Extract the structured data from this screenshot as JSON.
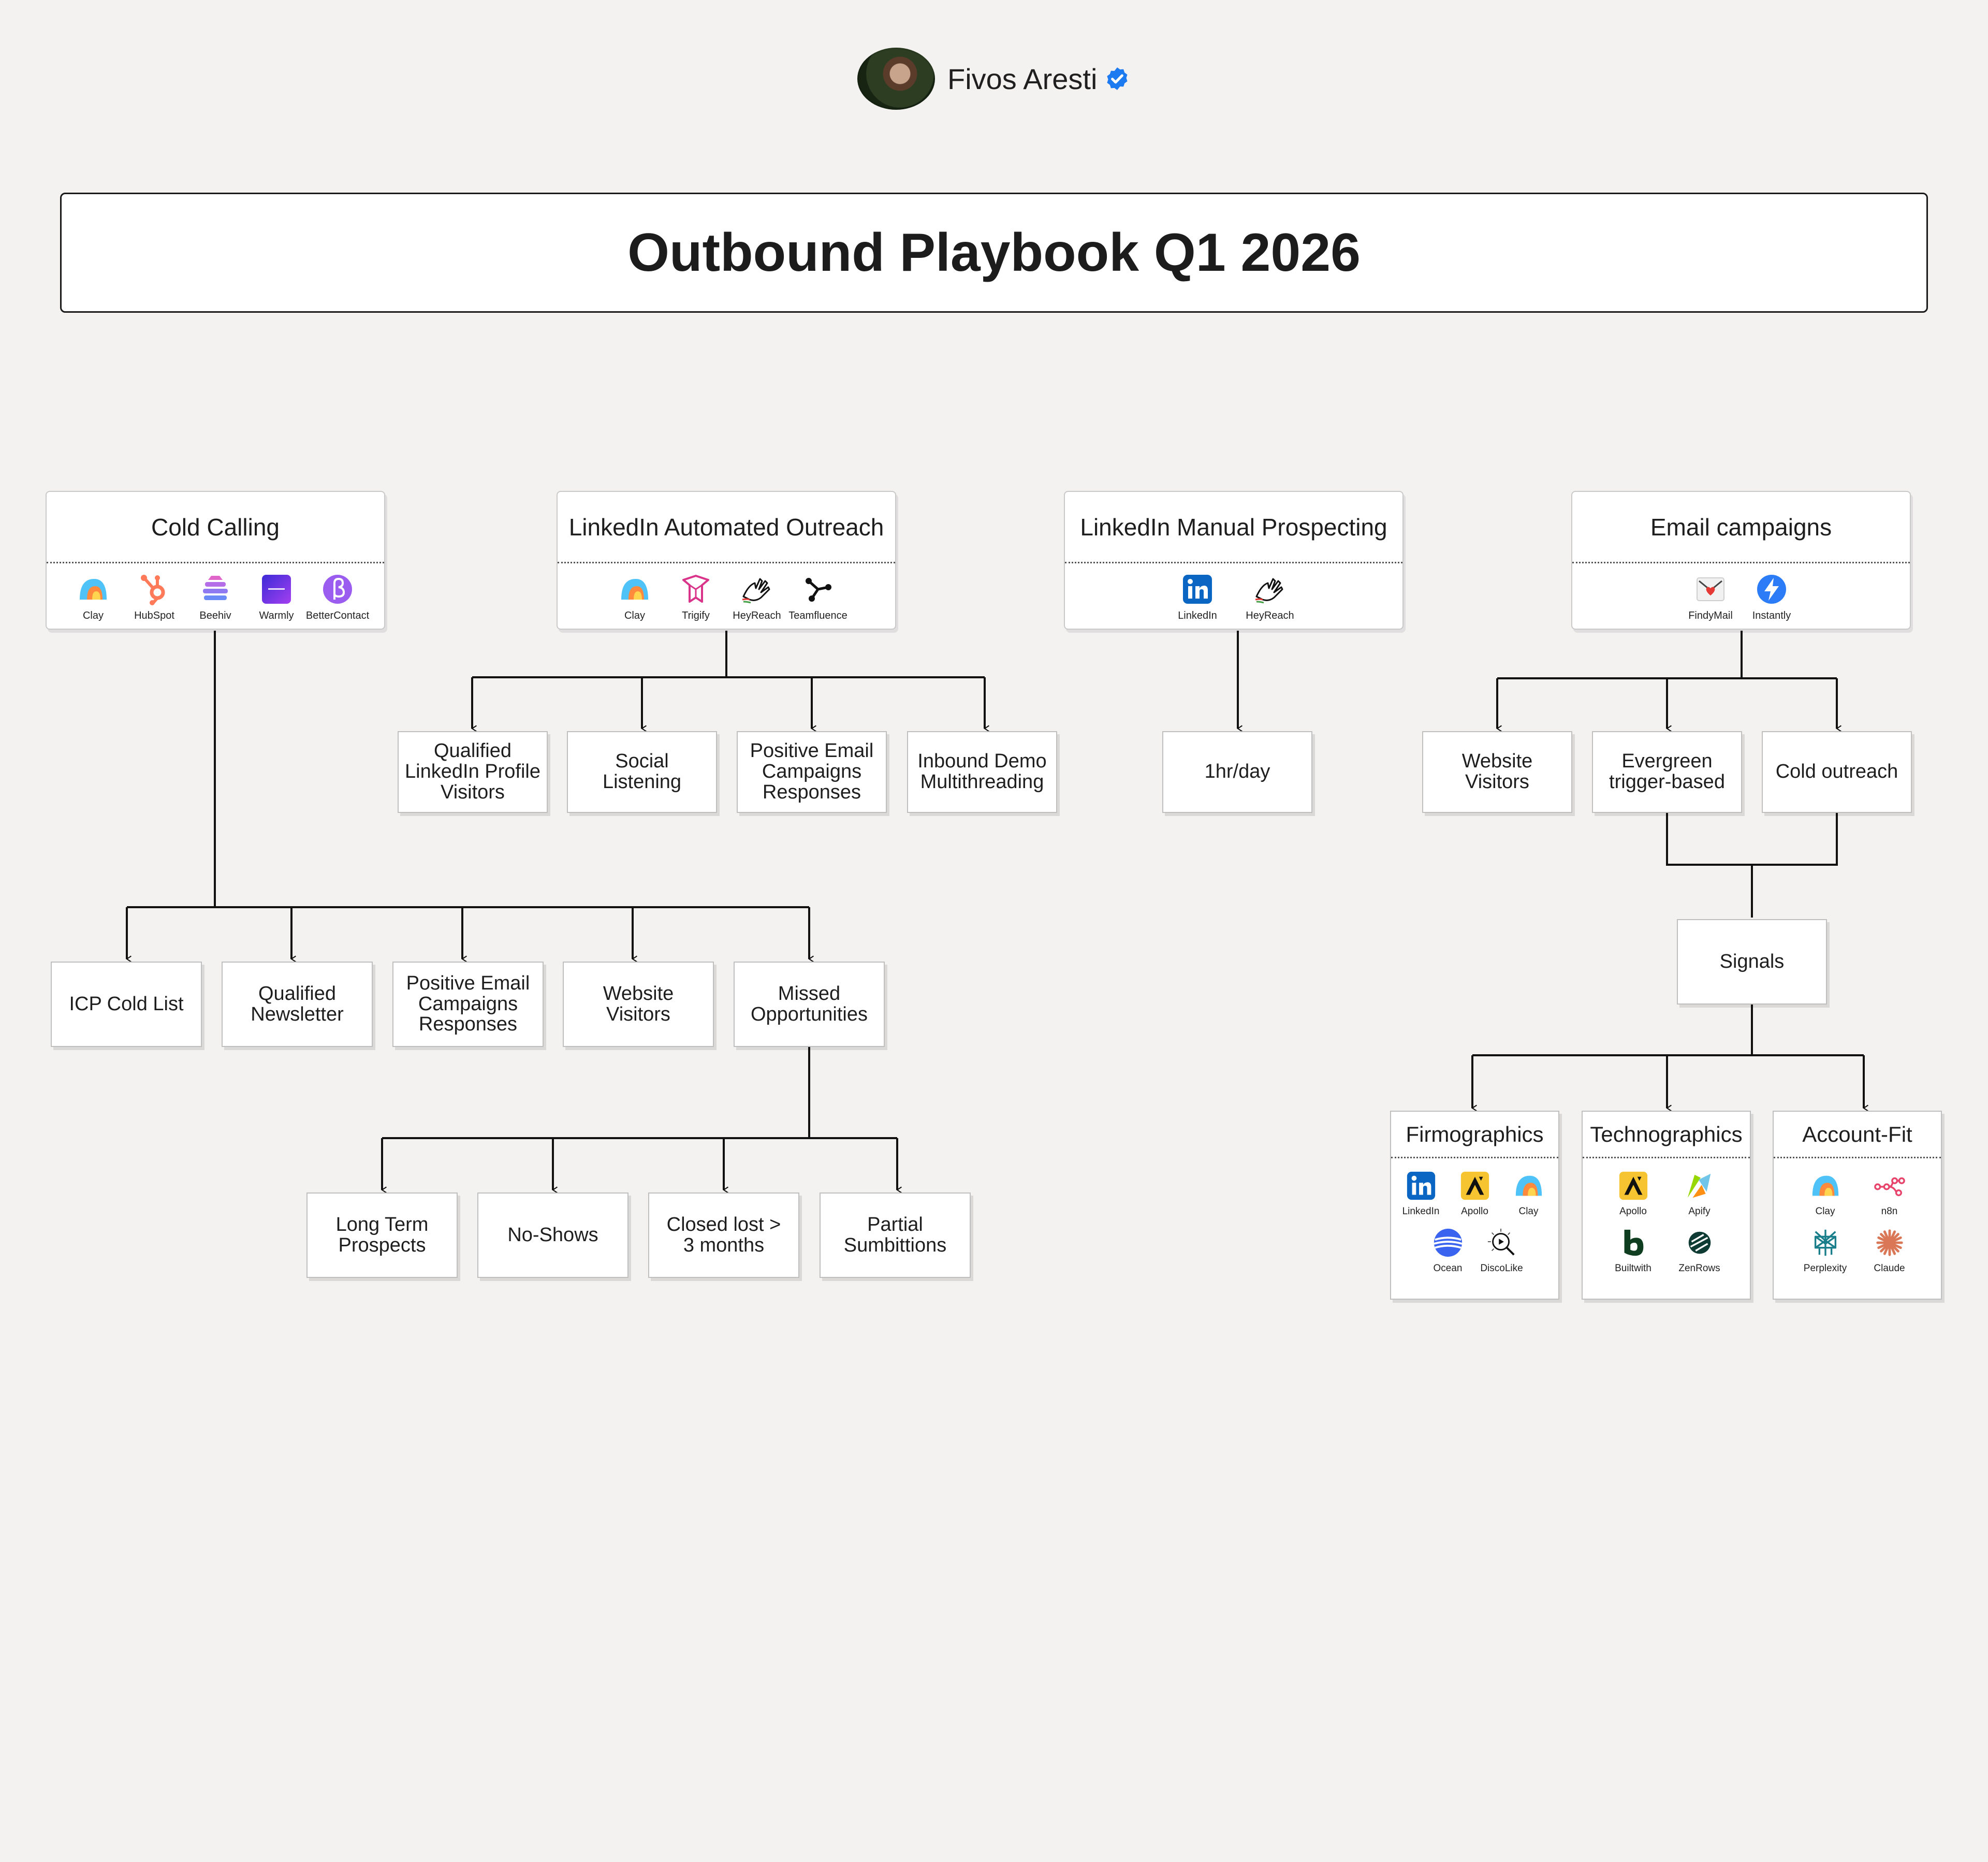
{
  "author": {
    "name": "Fivos Aresti"
  },
  "title": "Outbound Playbook Q1 2026",
  "categories": {
    "cold_calling": {
      "label": "Cold Calling",
      "tools": [
        "Clay",
        "HubSpot",
        "Beehiv",
        "Warmly",
        "BetterContact"
      ],
      "children": [
        "ICP Cold List",
        "Qualified\nNewsletter",
        "Positive Email\nCampaigns\nResponses",
        "Website\nVisitors",
        "Missed\nOpportunities"
      ]
    },
    "linkedin_automated": {
      "label": "LinkedIn Automated Outreach",
      "tools": [
        "Clay",
        "Trigify",
        "HeyReach",
        "Teamfluence"
      ],
      "children": [
        "Qualified\nLinkedIn Profile\nVisitors",
        "Social\nListening",
        "Positive Email\nCampaigns\nResponses",
        "Inbound Demo\nMultithreading"
      ]
    },
    "linkedin_manual": {
      "label": "LinkedIn Manual Prospecting",
      "tools": [
        "LinkedIn",
        "HeyReach"
      ],
      "children": [
        "1hr/day"
      ]
    },
    "email_campaigns": {
      "label": "Email campaigns",
      "tools": [
        "FindyMail",
        "Instantly"
      ],
      "children": [
        "Website\nVisitors",
        "Evergreen\ntrigger-based",
        "Cold outreach"
      ]
    }
  },
  "missed_opportunities": {
    "children": [
      "Long Term\nProspects",
      "No-Shows",
      "Closed lost >\n3 months",
      "Partial\nSumbittions"
    ]
  },
  "signals": {
    "label": "Signals",
    "groups": [
      {
        "label": "Firmographics",
        "tools": [
          "LinkedIn",
          "Apollo",
          "Clay",
          "Ocean",
          "DiscoLike"
        ]
      },
      {
        "label": "Technographics",
        "tools": [
          "Apollo",
          "Apify",
          "Builtwith",
          "ZenRows"
        ]
      },
      {
        "label": "Account-Fit",
        "tools": [
          "Clay",
          "n8n",
          "Perplexity",
          "Claude"
        ]
      }
    ]
  },
  "icons": {
    "verified": "verified-badge-icon",
    "Clay": "clay-icon",
    "HubSpot": "hubspot-icon",
    "Beehiv": "beehiv-icon",
    "Warmly": "warmly-icon",
    "BetterContact": "bettercontact-icon",
    "Trigify": "trigify-icon",
    "HeyReach": "heyreach-icon",
    "Teamfluence": "teamfluence-icon",
    "LinkedIn": "linkedin-icon",
    "FindyMail": "findymail-icon",
    "Instantly": "instantly-icon",
    "Apollo": "apollo-icon",
    "Ocean": "ocean-icon",
    "DiscoLike": "discolike-icon",
    "Apify": "apify-icon",
    "Builtwith": "builtwith-icon",
    "ZenRows": "zenrows-icon",
    "n8n": "n8n-icon",
    "Perplexity": "perplexity-icon",
    "Claude": "claude-icon"
  },
  "colors": {
    "background": "#f4f1f1",
    "stroke": "#111111",
    "verified": "#1d7bf2",
    "linkedin": "#0a66c2",
    "apollo": "#f6c431",
    "hubspot": "#ff7a59"
  }
}
